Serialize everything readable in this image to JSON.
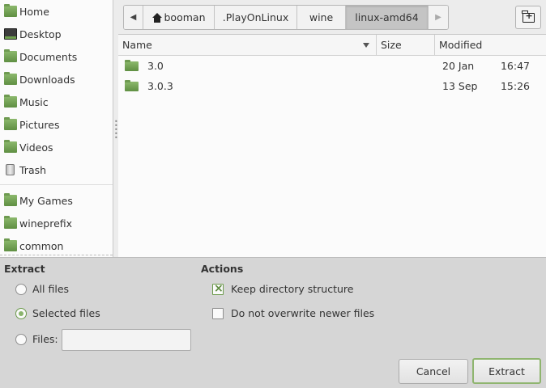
{
  "sidebar": {
    "places": [
      {
        "label": "Home",
        "icon": "home-folder-icon"
      },
      {
        "label": "Desktop",
        "icon": "desktop-icon"
      },
      {
        "label": "Documents",
        "icon": "documents-folder-icon"
      },
      {
        "label": "Downloads",
        "icon": "downloads-folder-icon"
      },
      {
        "label": "Music",
        "icon": "music-folder-icon"
      },
      {
        "label": "Pictures",
        "icon": "pictures-folder-icon"
      },
      {
        "label": "Videos",
        "icon": "videos-folder-icon"
      },
      {
        "label": "Trash",
        "icon": "trash-icon"
      }
    ],
    "bookmarks": [
      {
        "label": "My Games",
        "icon": "folder-icon"
      },
      {
        "label": "wineprefix",
        "icon": "folder-icon"
      },
      {
        "label": "common",
        "icon": "folder-icon"
      }
    ]
  },
  "pathbar": {
    "back_icon": "left-arrow-icon",
    "forward_icon": "right-arrow-icon",
    "segments": [
      "booman",
      ".PlayOnLinux",
      "wine",
      "linux-amd64"
    ],
    "active_segment": "linux-amd64"
  },
  "toolbar": {
    "new_folder_icon": "new-folder-icon"
  },
  "filelist": {
    "columns": {
      "name": "Name",
      "size": "Size",
      "modified": "Modified"
    },
    "sort_column": "Name",
    "sort_order": "descending",
    "rows": [
      {
        "name": "3.0",
        "size": "",
        "date": "20 Jan",
        "time": "16:47"
      },
      {
        "name": "3.0.3",
        "size": "",
        "date": "13 Sep",
        "time": "15:26"
      }
    ]
  },
  "extract": {
    "title": "Extract",
    "all_files": "All files",
    "selected_files": "Selected files",
    "files": "Files:",
    "files_value": "",
    "selected_option": "selected_files"
  },
  "actions": {
    "title": "Actions",
    "keep_structure": "Keep directory structure",
    "keep_structure_checked": true,
    "no_overwrite": "Do not overwrite newer files",
    "no_overwrite_checked": false
  },
  "buttons": {
    "cancel": "Cancel",
    "extract": "Extract"
  },
  "colors": {
    "accent": "#8ab46c",
    "folder": "#7aa75a"
  }
}
